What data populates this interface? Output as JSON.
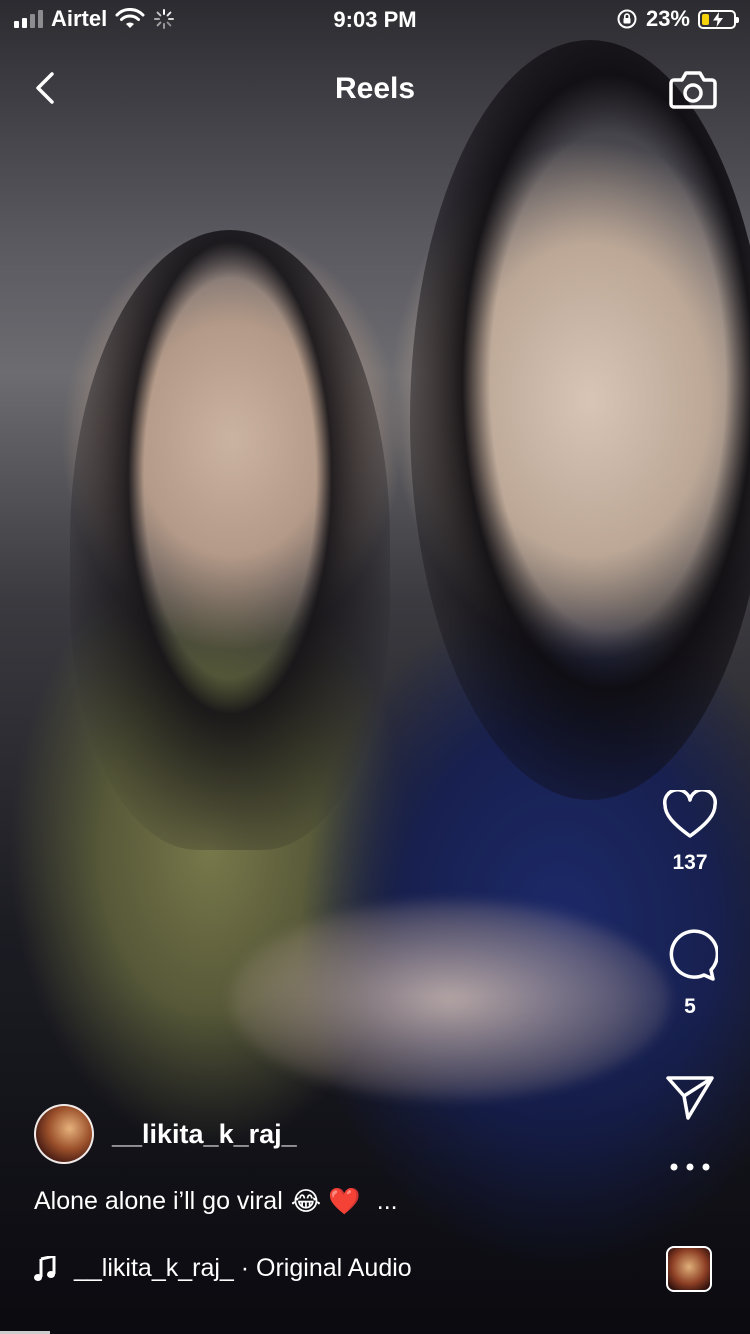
{
  "status": {
    "carrier": "Airtel",
    "time": "9:03 PM",
    "battery": "23%",
    "battery_level": 0.23,
    "battery_fill_color": "#f5d20a"
  },
  "header": {
    "title": "Reels",
    "back_icon": "chevron-left-icon",
    "camera_icon": "camera-icon"
  },
  "actions": {
    "likes": "137",
    "comments": "5",
    "like_icon": "heart-icon",
    "comment_icon": "comment-bubble-icon",
    "share_icon": "paper-plane-icon",
    "more_icon": "more-dots-icon"
  },
  "post": {
    "username": "__likita_k_raj_",
    "caption_text": "Alone alone i’ll go viral",
    "caption_emojis": "😂 ❤️",
    "caption_more": "...",
    "audio": "__likita_k_raj_ · Original Audio"
  }
}
